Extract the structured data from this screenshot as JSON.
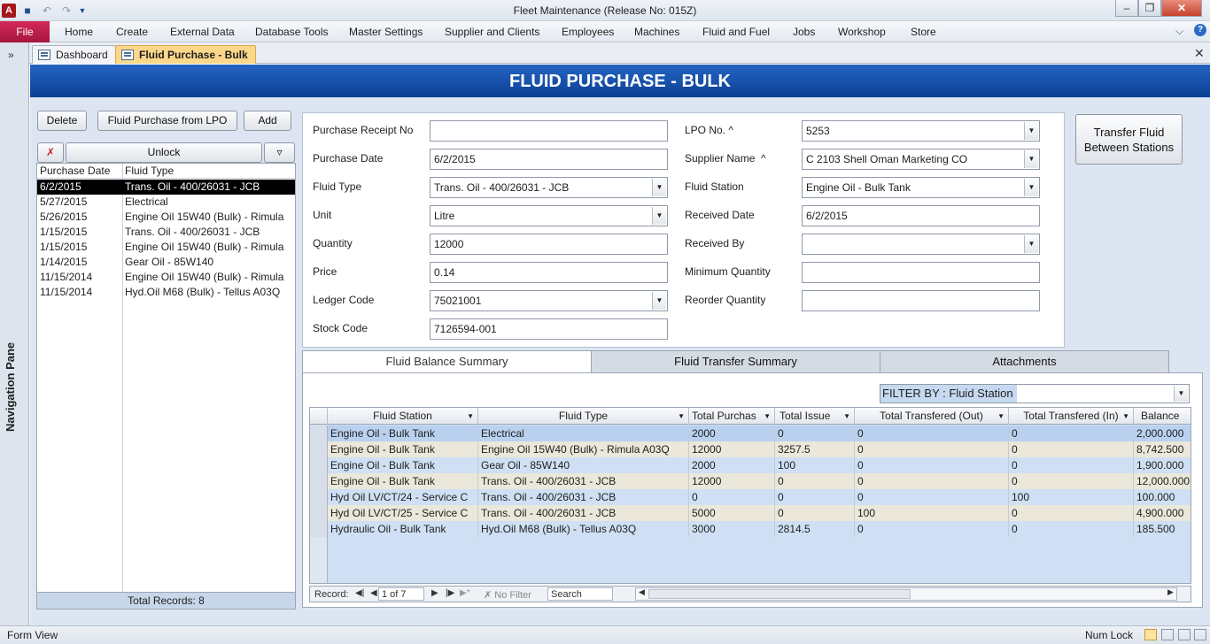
{
  "app": {
    "title": "Fleet Maintenance (Release No: 015Z)",
    "icon_letter": "A"
  },
  "ribbon": {
    "file_label": "File",
    "tabs": [
      "Home",
      "Create",
      "External Data",
      "Database Tools",
      "Master Settings",
      "Supplier and Clients",
      "Employees",
      "Machines",
      "Fluid and Fuel",
      "Jobs",
      "Workshop",
      "Store"
    ]
  },
  "nav_pane": {
    "label": "Navigation Pane"
  },
  "doc_tabs": [
    {
      "label": "Dashboard",
      "active": false
    },
    {
      "label": "Fluid Purchase - Bulk",
      "active": true
    }
  ],
  "form": {
    "title": "FLUID PURCHASE - BULK",
    "buttons": {
      "delete": "Delete",
      "from_lpo": "Fluid Purchase from LPO",
      "add": "Add",
      "unlock": "Unlock",
      "transfer": "Transfer Fluid Between Stations"
    },
    "list": {
      "headers": [
        "Purchase Date",
        "Fluid Type"
      ],
      "rows": [
        {
          "date": "6/2/2015",
          "type": "Trans. Oil - 400/26031 - JCB"
        },
        {
          "date": "5/27/2015",
          "type": "Electrical"
        },
        {
          "date": "5/26/2015",
          "type": "Engine Oil 15W40 (Bulk) - Rimula"
        },
        {
          "date": "1/15/2015",
          "type": "Trans. Oil - 400/26031 - JCB"
        },
        {
          "date": "1/15/2015",
          "type": "Engine Oil 15W40 (Bulk) - Rimula"
        },
        {
          "date": "1/14/2015",
          "type": "Gear Oil - 85W140"
        },
        {
          "date": "11/15/2014",
          "type": "Engine Oil 15W40 (Bulk) - Rimula"
        },
        {
          "date": "11/15/2014",
          "type": "Hyd.Oil M68 (Bulk) - Tellus A03Q"
        }
      ],
      "total": "Total Records: 8"
    },
    "left_fields": [
      {
        "label": "Purchase Receipt No",
        "value": "",
        "dropdown": false
      },
      {
        "label": "Purchase Date",
        "value": "6/2/2015",
        "dropdown": false
      },
      {
        "label": "Fluid Type",
        "value": "Trans. Oil - 400/26031 - JCB",
        "dropdown": true
      },
      {
        "label": "Unit",
        "value": "Litre",
        "dropdown": true
      },
      {
        "label": "Quantity",
        "value": "12000",
        "dropdown": false
      },
      {
        "label": "Price",
        "value": "0.14",
        "dropdown": false
      },
      {
        "label": "Ledger Code",
        "value": "75021001",
        "dropdown": true
      },
      {
        "label": "Stock Code",
        "value": "7126594-001",
        "dropdown": false
      }
    ],
    "right_fields": [
      {
        "label": "LPO No. ^",
        "value": "5253",
        "dropdown": true
      },
      {
        "label": "Supplier Name  ^",
        "value": "C 2103 Shell Oman Marketing CO",
        "dropdown": true
      },
      {
        "label": "Fluid Station",
        "value": "Engine Oil - Bulk Tank",
        "dropdown": true
      },
      {
        "label": "Received Date",
        "value": "6/2/2015",
        "dropdown": false
      },
      {
        "label": "Received By",
        "value": "",
        "dropdown": true
      },
      {
        "label": "Minimum Quantity",
        "value": "",
        "dropdown": false
      },
      {
        "label": "Reorder Quantity",
        "value": "",
        "dropdown": false
      }
    ],
    "subtabs": [
      "Fluid Balance Summary",
      "Fluid Transfer Summary",
      "Attachments"
    ],
    "filter_label": "FILTER BY : Fluid Station",
    "grid": {
      "headers": [
        "Fluid Station",
        "Fluid Type",
        "Total Purchas",
        "Total Issue",
        "Total Transfered (Out)",
        "Total Transfered (In)",
        "Balance"
      ],
      "rows": [
        [
          "Engine Oil - Bulk Tank",
          "Electrical",
          "2000",
          "0",
          "0",
          "0",
          "2,000.000"
        ],
        [
          "Engine Oil - Bulk Tank",
          "Engine Oil 15W40 (Bulk) - Rimula A03Q",
          "12000",
          "3257.5",
          "0",
          "0",
          "8,742.500"
        ],
        [
          "Engine Oil - Bulk Tank",
          "Gear Oil - 85W140",
          "2000",
          "100",
          "0",
          "0",
          "1,900.000"
        ],
        [
          "Engine Oil - Bulk Tank",
          "Trans. Oil - 400/26031 - JCB",
          "12000",
          "0",
          "0",
          "0",
          "12,000.000"
        ],
        [
          "Hyd Oil LV/CT/24 - Service C",
          "Trans. Oil - 400/26031 - JCB",
          "0",
          "0",
          "0",
          "100",
          "100.000"
        ],
        [
          "Hyd Oil LV/CT/25 - Service C",
          "Trans. Oil - 400/26031 - JCB",
          "5000",
          "0",
          "100",
          "0",
          "4,900.000"
        ],
        [
          "Hydraulic Oil - Bulk Tank",
          "Hyd.Oil M68 (Bulk) - Tellus A03Q",
          "3000",
          "2814.5",
          "0",
          "0",
          "185.500"
        ]
      ]
    },
    "record_nav": {
      "label": "Record:",
      "position": "1 of 7",
      "no_filter": "No Filter",
      "search": "Search"
    }
  },
  "status": {
    "left": "Form View",
    "numlock": "Num Lock"
  }
}
